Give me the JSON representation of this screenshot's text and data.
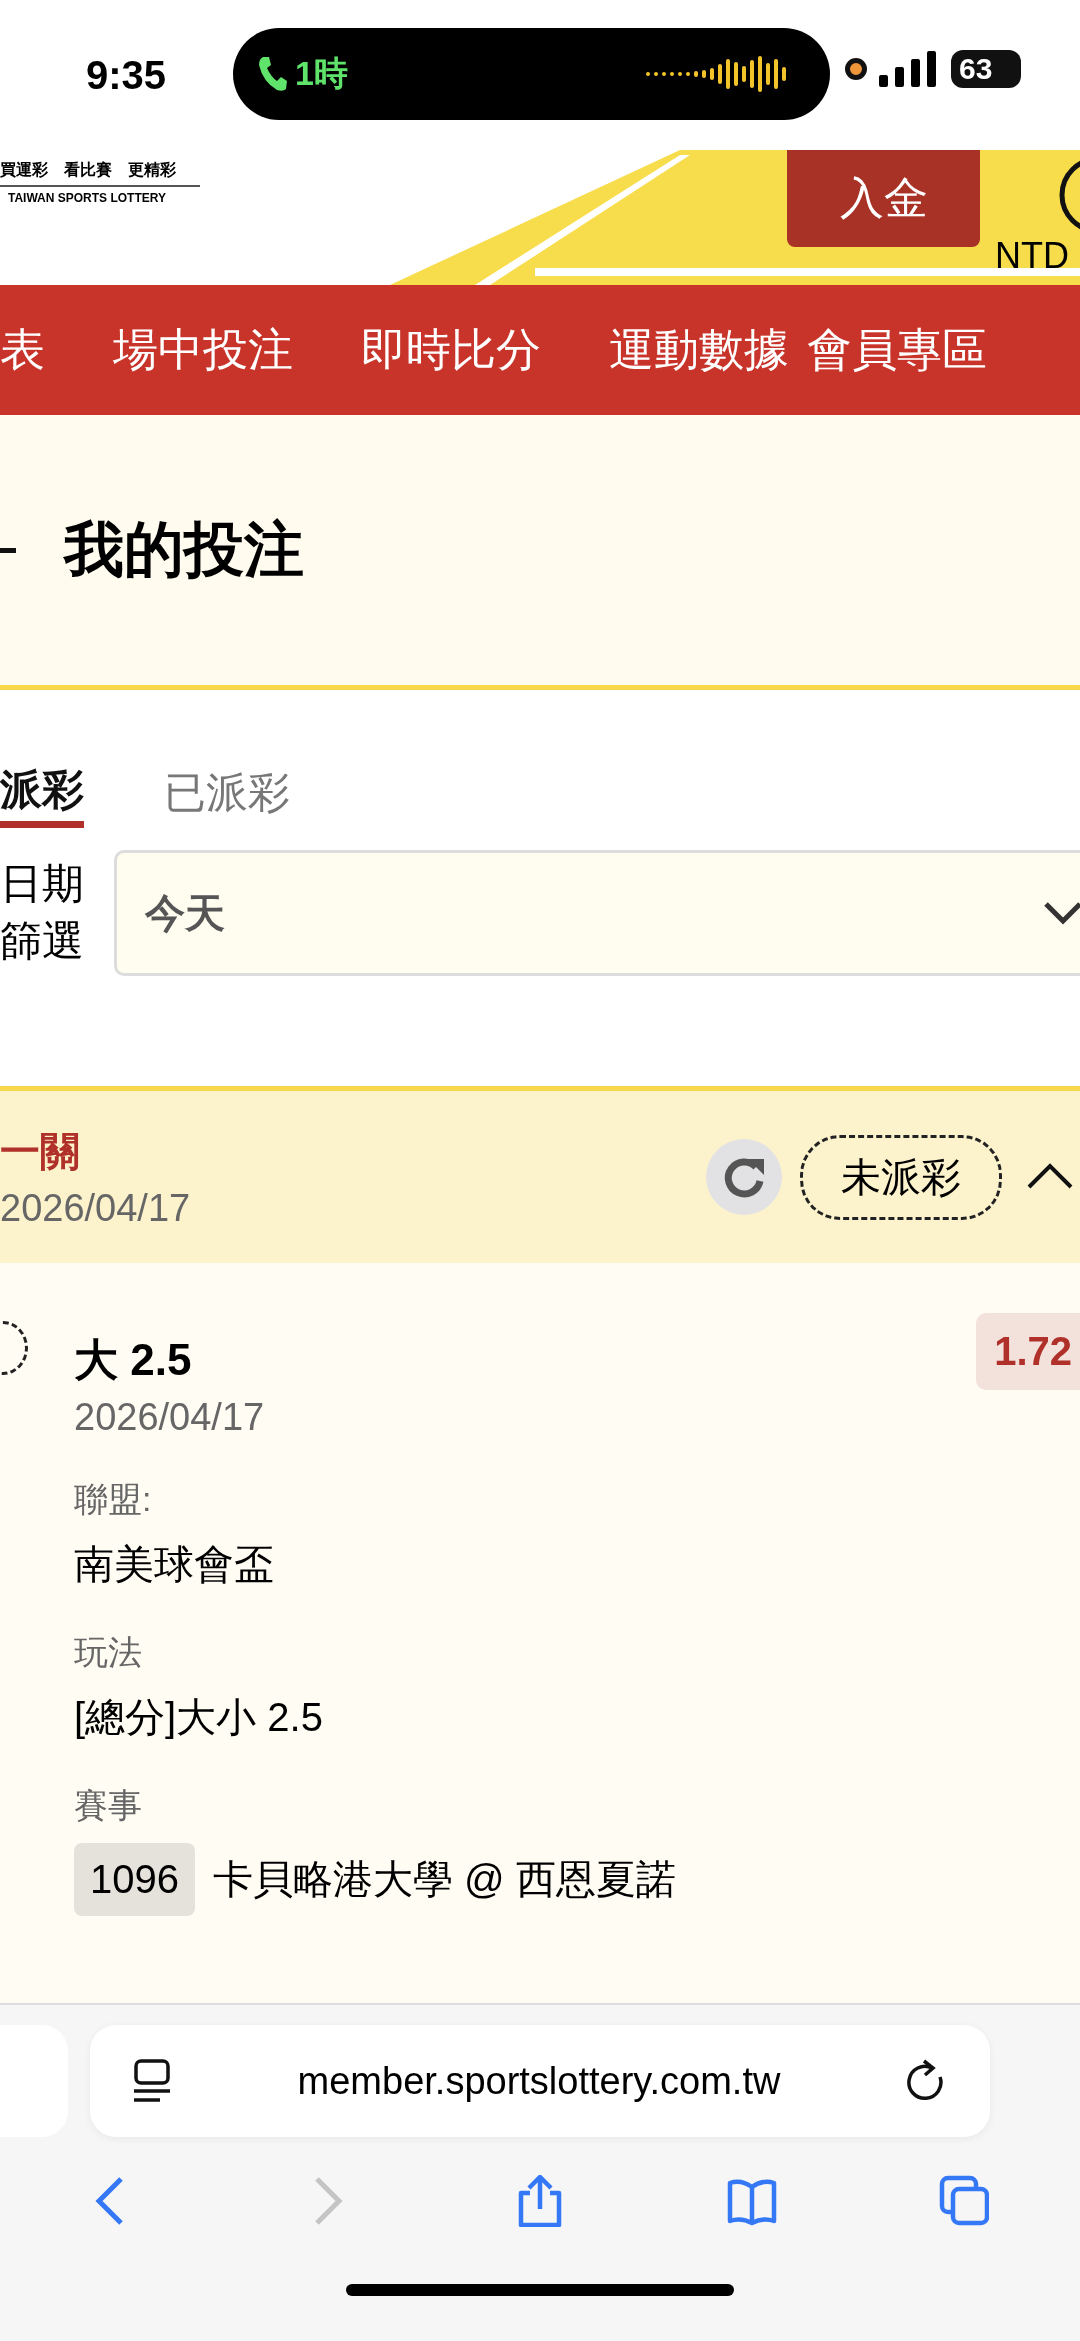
{
  "status_bar": {
    "time": "9:35",
    "call_duration": "1時",
    "battery": "63"
  },
  "header": {
    "logo_slogan": "買運彩　看比賽　更精彩",
    "logo_text": "TAIWAN SPORTS LOTTERY",
    "deposit_button": "入金",
    "currency": "NTD"
  },
  "nav": [
    {
      "label": "表"
    },
    {
      "label": "場中投注"
    },
    {
      "label": "即時比分"
    },
    {
      "label": "運動數據"
    },
    {
      "label": "會員專區"
    }
  ],
  "page_title": "我的投注",
  "tabs": [
    {
      "label": "派彩",
      "selected": true
    },
    {
      "label": "已派彩",
      "selected": false
    }
  ],
  "date_filter": {
    "label": "日期篩選",
    "value": "今天"
  },
  "bet": {
    "type": "一關",
    "date": "2026/04/17",
    "status": "未派彩",
    "expanded": true,
    "selection": {
      "selected": false,
      "name": "大 2.5",
      "date": "2026/04/17",
      "odds": "1.72",
      "fields": [
        {
          "label": "聯盟:",
          "value": "南美球會盃"
        },
        {
          "label": "玩法",
          "value": "[總分]大小 2.5"
        },
        {
          "label": "賽事",
          "code": "1096",
          "value": "卡貝略港大學 @ 西恩夏諾"
        }
      ]
    }
  },
  "browser": {
    "url": "member.sportslottery.com.tw",
    "buttons": [
      {
        "kind": "back",
        "disabled": false
      },
      {
        "kind": "forward",
        "disabled": true
      },
      {
        "kind": "share",
        "disabled": false
      },
      {
        "kind": "bookmarks",
        "disabled": false
      },
      {
        "kind": "tabs",
        "disabled": false
      }
    ]
  }
}
